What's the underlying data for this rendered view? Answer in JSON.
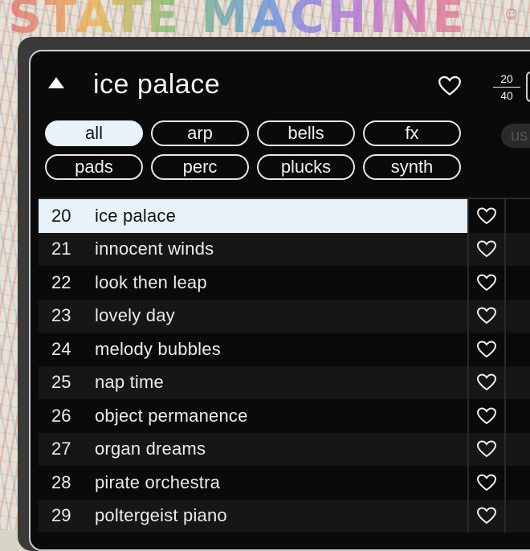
{
  "banner": {
    "text": "STATE MACHINE"
  },
  "header": {
    "title": "ice palace",
    "counter_top": "20",
    "counter_bottom": "40"
  },
  "filters": [
    {
      "label": "all",
      "active": true
    },
    {
      "label": "arp",
      "active": false
    },
    {
      "label": "bells",
      "active": false
    },
    {
      "label": "fx",
      "active": false
    },
    {
      "label": "pads",
      "active": false
    },
    {
      "label": "perc",
      "active": false
    },
    {
      "label": "plucks",
      "active": false
    },
    {
      "label": "synth",
      "active": false
    }
  ],
  "user_filter": {
    "label": "us"
  },
  "presets": [
    {
      "number": "20",
      "name": "ice palace",
      "selected": true
    },
    {
      "number": "21",
      "name": "innocent winds",
      "selected": false
    },
    {
      "number": "22",
      "name": "look then leap",
      "selected": false
    },
    {
      "number": "23",
      "name": "lovely day",
      "selected": false
    },
    {
      "number": "24",
      "name": "melody bubbles",
      "selected": false
    },
    {
      "number": "25",
      "name": "nap time",
      "selected": false
    },
    {
      "number": "26",
      "name": "object permanence",
      "selected": false
    },
    {
      "number": "27",
      "name": "organ dreams",
      "selected": false
    },
    {
      "number": "28",
      "name": "pirate orchestra",
      "selected": false
    },
    {
      "number": "29",
      "name": "poltergeist piano",
      "selected": false
    }
  ],
  "icons": {
    "collapse": "triangle-up-icon",
    "favorite": "heart-outline-icon"
  },
  "colors": {
    "panel_bg": "#0a0a0a",
    "selected_row": "#e8f2f9",
    "text": "#ececec"
  }
}
